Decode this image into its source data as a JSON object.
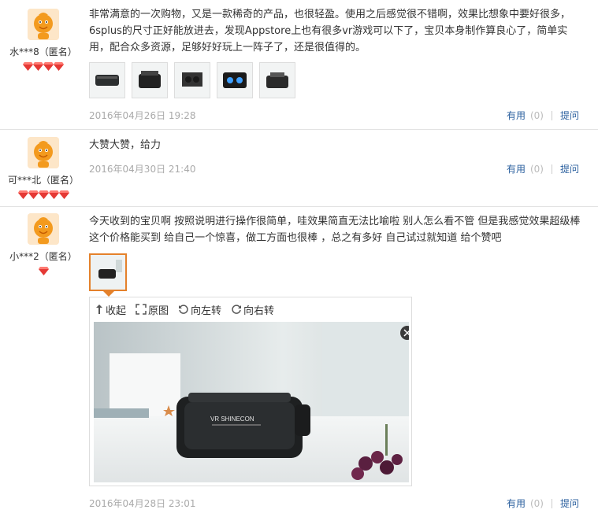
{
  "reviews": [
    {
      "user": "水***8（匿名）",
      "gem_count": 4,
      "text": "非常满意的一次购物，又是一款稀奇的产品，也很轻盈。使用之后感觉很不错啊，效果比想象中要好很多，6splus的尺寸正好能放进去，发现Appstore上也有很多vr游戏可以下了，宝贝本身制作算良心了，简单实用，配合众多资源，足够好好玩上一阵子了，还是很值得的。",
      "date": "2016年04月26日 19:28",
      "useful_label": "有用",
      "useful_count": "(0)",
      "reply_label": "提问"
    },
    {
      "user": "可***北（匿名）",
      "gem_count": 5,
      "text": "大赞大赞，给力",
      "date": "2016年04月30日 21:40",
      "useful_label": "有用",
      "useful_count": "(0)",
      "reply_label": "提问"
    },
    {
      "user": "小***2（匿名）",
      "gem_count": 1,
      "text": "今天收到的宝贝啊 按照说明进行操作很简单，哇效果简直无法比喻啦 别人怎么看不管 但是我感觉效果超级棒 这个价格能买到 给自己一个惊喜，做工方面也很棒 ，总之有多好 自己试过就知道 给个赞吧",
      "date": "2016年04月28日 23:01",
      "useful_label": "有用",
      "useful_count": "(0)",
      "reply_label": "提问"
    }
  ],
  "viewer": {
    "collapse": "收起",
    "original": "原图",
    "rotate_left": "向左转",
    "rotate_right": "向右转",
    "brand_text": "VR SHINECON"
  },
  "colors": {
    "link": "#2a5f9e",
    "date": "#aaaaaa",
    "accent": "#e4812b",
    "gem": "#e53935"
  }
}
